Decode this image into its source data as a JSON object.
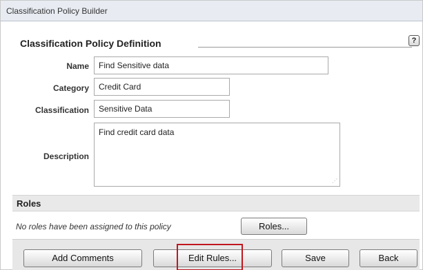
{
  "window": {
    "title": "Classification Policy Builder"
  },
  "definition": {
    "header": "Classification Policy Definition",
    "help_icon": "?",
    "name_label": "Name",
    "name_value": "Find Sensitive data",
    "category_label": "Category",
    "category_value": "Credit Card",
    "classification_label": "Classification",
    "classification_value": "Sensitive Data",
    "description_label": "Description",
    "description_value": "Find credit card data"
  },
  "roles": {
    "title": "Roles",
    "note": "No roles have been assigned to this policy",
    "button_label": "Roles..."
  },
  "footer": {
    "add_comments_label": "Add Comments",
    "edit_rules_label": "Edit Rules...",
    "save_label": "Save",
    "back_label": "Back"
  },
  "colors": {
    "highlight": "#c0161f",
    "titlebar_bg": "#e8ecf2",
    "section_bar_bg": "#e9e9e9"
  }
}
